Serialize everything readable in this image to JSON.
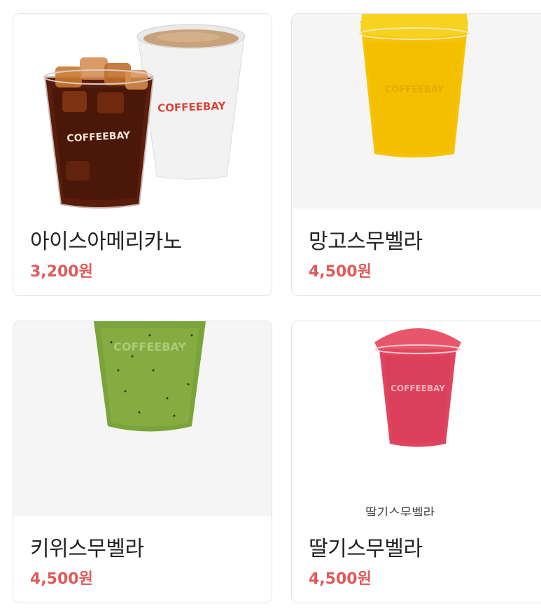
{
  "products": [
    {
      "name": "아이스아메리카노",
      "price": "3,200원",
      "brand": "COFFEEBAY",
      "image": "iced-americano-and-hot-coffee-cups"
    },
    {
      "name": "망고스무벨라",
      "price": "4,500원",
      "brand": "COFFEEBAY",
      "image": "mango-smoothie-cup"
    },
    {
      "name": "키위스무벨라",
      "price": "4,500원",
      "brand": "COFFEEBAY",
      "image": "kiwi-smoothie-cup"
    },
    {
      "name": "딸기스무벨라",
      "price": "4,500원",
      "brand": "COFFEEBAY",
      "image": "strawberry-smoothie-cup",
      "image_caption": "딸기스무벨라"
    }
  ],
  "colors": {
    "price": "#e05a5a",
    "name": "#222222",
    "card_border": "#e3e3e3",
    "brand_red": "#d9473a",
    "mango": "#f5c400",
    "kiwi": "#7aa33a",
    "strawberry": "#e0455f",
    "americano": "#5a1d0c"
  }
}
